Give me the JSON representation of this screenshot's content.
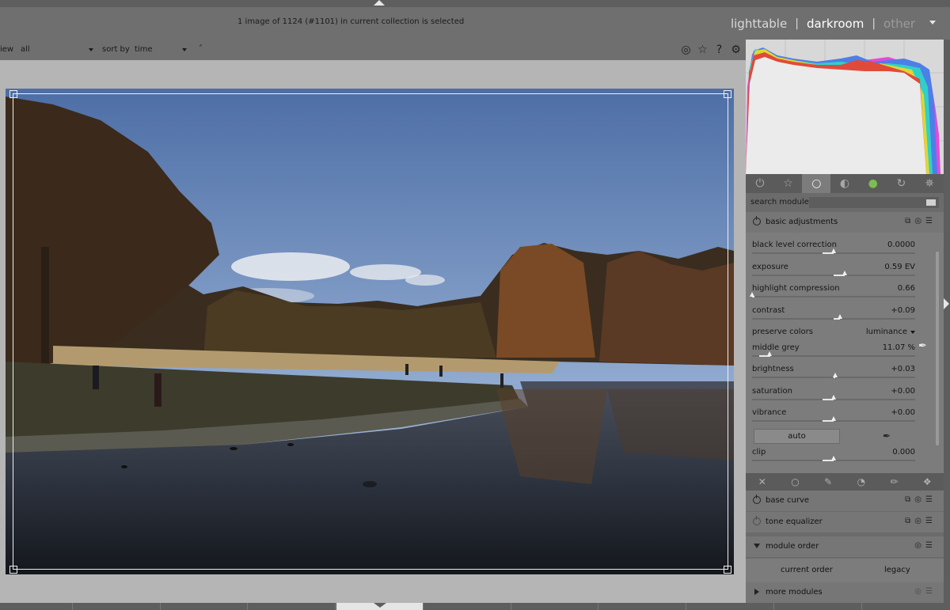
{
  "header": {
    "status": "1 image of 1124 (#1101) in current collection is selected",
    "views": [
      "lighttable",
      "darkroom",
      "other"
    ],
    "separator": "|"
  },
  "filterbar": {
    "view_label": "iew",
    "view_value": "all",
    "sort_label": "sort by",
    "sort_value": "time",
    "sort_direction": "˄"
  },
  "icons": {
    "filter_bar": [
      "grouping-icon",
      "star-icon",
      "help-icon",
      "gear-icon"
    ],
    "module_groups": [
      "power-icon",
      "star-icon",
      "circle-icon",
      "tone-icon",
      "color-icon",
      "correct-icon",
      "effect-icon"
    ]
  },
  "search": {
    "label": "search module",
    "placeholder": ""
  },
  "basic_adjustments": {
    "title": "basic adjustments",
    "sliders": [
      {
        "label": "black level correction",
        "value": "0.0000",
        "level": 0.5
      },
      {
        "label": "exposure",
        "value": "0.59 EV",
        "level": 0.57
      },
      {
        "label": "highlight compression",
        "value": "0.66",
        "level": 0.0
      },
      {
        "label": "contrast",
        "value": "+0.09",
        "level": 0.54
      },
      {
        "label": "middle grey",
        "value": "11.07 %",
        "level": 0.11
      },
      {
        "label": "brightness",
        "value": "+0.03",
        "level": 0.51
      },
      {
        "label": "saturation",
        "value": "+0.00",
        "level": 0.5
      },
      {
        "label": "vibrance",
        "value": "+0.00",
        "level": 0.5
      },
      {
        "label": "clip",
        "value": "0.000",
        "level": 0.5
      }
    ],
    "preserve_colors_label": "preserve colors",
    "preserve_colors_value": "luminance",
    "auto_label": "auto"
  },
  "modules": {
    "base_curve": "base curve",
    "tone_equalizer": "tone equalizer",
    "module_order": "module order",
    "module_order_current": "current order",
    "module_order_legacy": "legacy",
    "more_modules": "more modules"
  },
  "colors": {
    "accent_active_view": "#ffffff",
    "panel_bg": "#7c7c7c",
    "center_bg": "#b5b5b5"
  }
}
